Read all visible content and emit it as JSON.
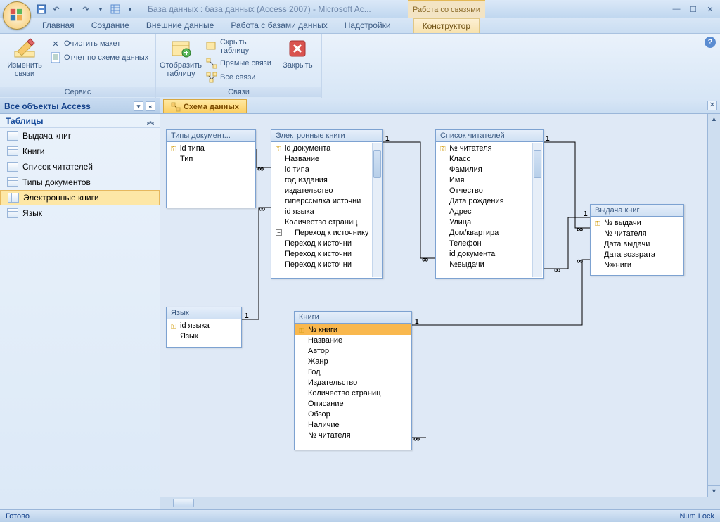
{
  "window": {
    "title": "База данных : база данных (Access 2007) - Microsoft Ac...",
    "contextual_title": "Работа со связями"
  },
  "ribbon_tabs": [
    "Главная",
    "Создание",
    "Внешние данные",
    "Работа с базами данных",
    "Надстройки"
  ],
  "ribbon_tab_contextual": "Конструктор",
  "ribbon": {
    "group1": {
      "label": "Сервис",
      "big": "Изменить связи",
      "btn_clear": "Очистить макет",
      "btn_report": "Отчет по схеме данных"
    },
    "group2": {
      "label": "Связи",
      "big1": "Отобразить таблицу",
      "btn_hide": "Скрыть таблицу",
      "btn_direct": "Прямые связи",
      "btn_all": "Все связи",
      "big2": "Закрыть"
    }
  },
  "nav": {
    "header": "Все объекты Access",
    "group": "Таблицы",
    "items": [
      "Выдача книг",
      "Книги",
      "Список читателей",
      "Типы документов",
      "Электронные книги",
      "Язык"
    ],
    "selected_index": 4
  },
  "doc_tab": "Схема данных",
  "tables": {
    "t1": {
      "title": "Типы документ...",
      "fields": [
        {
          "n": "id типа",
          "pk": true
        },
        {
          "n": "Тип"
        }
      ]
    },
    "t2": {
      "title": "Электронные книги",
      "fields": [
        {
          "n": "id документа",
          "pk": true
        },
        {
          "n": "Название"
        },
        {
          "n": "id типа"
        },
        {
          "n": "год издания"
        },
        {
          "n": "издательство"
        },
        {
          "n": "гиперссылка источни"
        },
        {
          "n": "id языка"
        },
        {
          "n": "Количество страниц"
        },
        {
          "n": "Переход к источнику",
          "exp": true
        },
        {
          "n": "Переход к источни"
        },
        {
          "n": "Переход к источни"
        },
        {
          "n": "Переход к источни"
        }
      ]
    },
    "t3": {
      "title": "Список читателей",
      "fields": [
        {
          "n": "№ читателя",
          "pk": true
        },
        {
          "n": "Класс"
        },
        {
          "n": "Фамилия"
        },
        {
          "n": "Имя"
        },
        {
          "n": "Отчество"
        },
        {
          "n": "Дата рождения"
        },
        {
          "n": "Адрес"
        },
        {
          "n": "Улица"
        },
        {
          "n": "Дом/квартира"
        },
        {
          "n": "Телефон"
        },
        {
          "n": "id документа"
        },
        {
          "n": "№выдачи"
        }
      ]
    },
    "t4": {
      "title": "Выдача книг",
      "fields": [
        {
          "n": "№ выдачи",
          "pk": true
        },
        {
          "n": "№ читателя"
        },
        {
          "n": "Дата выдачи"
        },
        {
          "n": "Дата возврата"
        },
        {
          "n": "№книги"
        }
      ]
    },
    "t5": {
      "title": "Язык",
      "fields": [
        {
          "n": "id языка",
          "pk": true
        },
        {
          "n": "Язык"
        }
      ]
    },
    "t6": {
      "title": "Книги",
      "fields": [
        {
          "n": "№ книги",
          "pk": true,
          "sel": true
        },
        {
          "n": "Название"
        },
        {
          "n": "Автор"
        },
        {
          "n": "Жанр"
        },
        {
          "n": "Год"
        },
        {
          "n": "Издательство"
        },
        {
          "n": "Количество страниц"
        },
        {
          "n": "Описание"
        },
        {
          "n": "Обзор"
        },
        {
          "n": "Наличие"
        },
        {
          "n": "№ читателя"
        }
      ]
    }
  },
  "status": {
    "left": "Готово",
    "right": "Num Lock"
  }
}
